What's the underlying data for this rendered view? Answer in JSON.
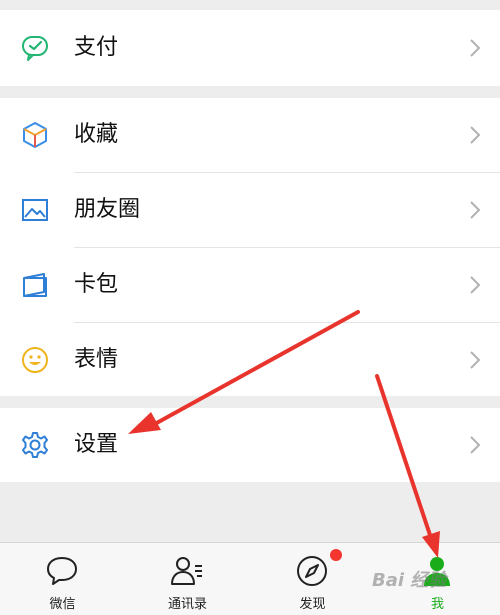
{
  "menu": {
    "pay": {
      "label": "支付",
      "icon": "pay-icon"
    },
    "favorites": {
      "label": "收藏",
      "icon": "favorites-cube-icon"
    },
    "moments": {
      "label": "朋友圈",
      "icon": "moments-photo-icon"
    },
    "cards": {
      "label": "卡包",
      "icon": "card-wallet-icon"
    },
    "stickers": {
      "label": "表情",
      "icon": "smiley-icon"
    },
    "settings": {
      "label": "设置",
      "icon": "gear-icon"
    }
  },
  "tabs": [
    {
      "label": "微信",
      "icon": "chat-bubble-icon",
      "active": false
    },
    {
      "label": "通讯录",
      "icon": "contacts-icon",
      "active": false
    },
    {
      "label": "发现",
      "icon": "compass-icon",
      "active": false,
      "badge": true
    },
    {
      "label": "我",
      "icon": "me-person-icon",
      "active": true
    }
  ],
  "watermark": "Bai 经验",
  "colors": {
    "accent_green": "#1aad19",
    "badge_red": "#f43530",
    "arrow_red": "#e8342c"
  }
}
